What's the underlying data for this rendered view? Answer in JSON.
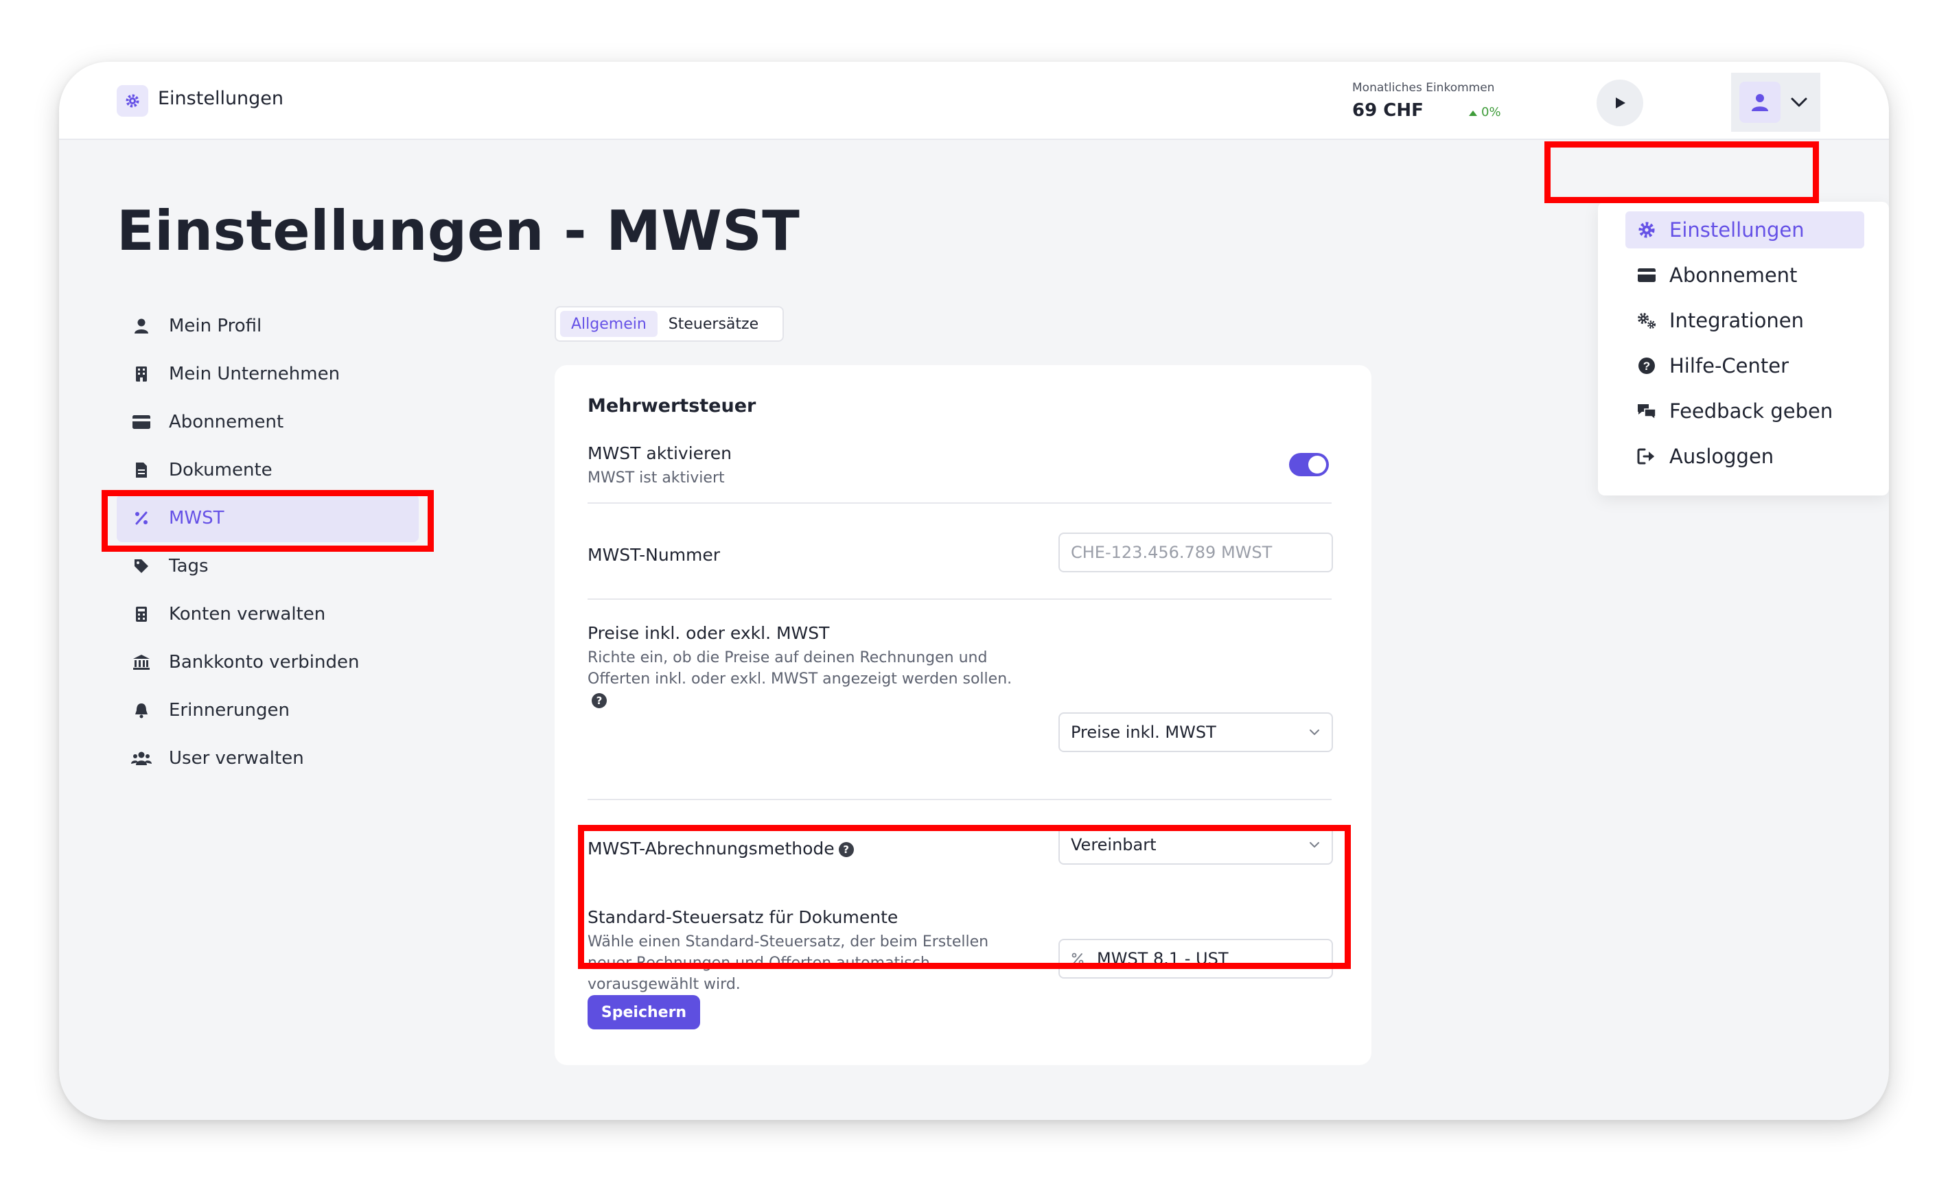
{
  "header": {
    "app_title": "Einstellungen",
    "income_label": "Monatliches Einkommen",
    "income_value": "69 CHF",
    "income_change": "0%"
  },
  "page": {
    "title": "Einstellungen - MWST"
  },
  "sidebar": {
    "items": [
      {
        "label": "Mein Profil",
        "icon": "user-icon"
      },
      {
        "label": "Mein Unternehmen",
        "icon": "building-icon"
      },
      {
        "label": "Abonnement",
        "icon": "credit-card-icon"
      },
      {
        "label": "Dokumente",
        "icon": "document-icon"
      },
      {
        "label": "MWST",
        "icon": "percent-icon",
        "active": true
      },
      {
        "label": "Tags",
        "icon": "tag-icon"
      },
      {
        "label": "Konten verwalten",
        "icon": "calculator-icon"
      },
      {
        "label": "Bankkonto verbinden",
        "icon": "bank-icon"
      },
      {
        "label": "Erinnerungen",
        "icon": "bell-icon"
      },
      {
        "label": "User verwalten",
        "icon": "users-icon"
      }
    ]
  },
  "tabs": [
    {
      "label": "Allgemein",
      "active": true
    },
    {
      "label": "Steuersätze",
      "active": false
    }
  ],
  "vat": {
    "section_title": "Mehrwertsteuer",
    "activate_label": "MWST aktivieren",
    "activate_status": "MWST ist aktiviert",
    "activate_on": true,
    "number_label": "MWST-Nummer",
    "number_placeholder": "CHE-123.456.789 MWST",
    "price_label": "Preise inkl. oder exkl. MWST",
    "price_desc": "Richte ein, ob die Preise auf deinen Rechnungen und Offerten inkl. oder exkl. MWST angezeigt werden sollen.",
    "price_value": "Preise inkl. MWST",
    "method_label": "MWST-Abrechnungsmethode",
    "method_value": "Vereinbart",
    "default_label": "Standard-Steuersatz für Dokumente",
    "default_desc": "Wähle einen Standard-Steuersatz, der beim Erstellen neuer Rechnungen und Offerten automatisch vorausgewählt wird.",
    "default_value": "MWST 8.1 - UST",
    "save_label": "Speichern"
  },
  "user_menu": {
    "items": [
      {
        "label": "Einstellungen",
        "icon": "gear-icon",
        "active": true
      },
      {
        "label": "Abonnement",
        "icon": "credit-card-icon"
      },
      {
        "label": "Integrationen",
        "icon": "cogs-icon"
      },
      {
        "label": "Hilfe-Center",
        "icon": "question-icon"
      },
      {
        "label": "Feedback geben",
        "icon": "comments-icon"
      },
      {
        "label": "Ausloggen",
        "icon": "logout-icon"
      }
    ]
  },
  "colors": {
    "accent": "#5e4fe0",
    "highlight": "#ff0000",
    "positive": "#3f9c3a"
  }
}
